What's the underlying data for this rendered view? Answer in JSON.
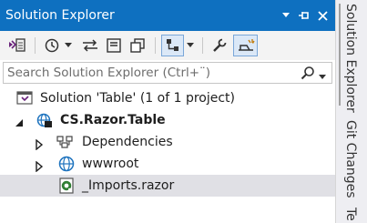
{
  "window": {
    "title": "Solution Explorer",
    "buttons": [
      "dropdown",
      "pin",
      "close"
    ]
  },
  "colors": {
    "titlebar": "#0e70c0",
    "selected_row": "#e0e0e5",
    "toolbar_bg": "#f3f3f3"
  },
  "toolbar": {
    "items": [
      "switch-views-icon",
      "history-icon",
      "sync-icon",
      "collapse-all-icon",
      "show-all-files-icon",
      "view-options-icon",
      "properties-icon",
      "preview-icon"
    ]
  },
  "search": {
    "placeholder": "Search Solution Explorer (Ctrl+¨)"
  },
  "tree": {
    "solution": "Solution 'Table' (1 of 1 project)",
    "project": "CS.Razor.Table",
    "dependencies": "Dependencies",
    "wwwroot": "wwwroot",
    "imports": "_Imports.razor"
  },
  "side_tabs": {
    "tab1": "Solution Explorer",
    "tab2": "Git Changes",
    "tab3": "Te"
  }
}
